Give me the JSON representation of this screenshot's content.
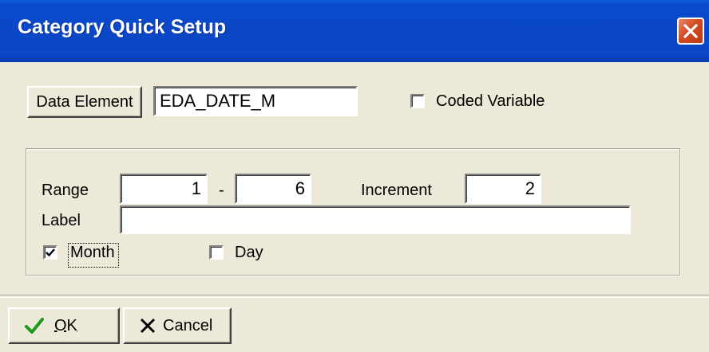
{
  "window": {
    "title": "Category Quick Setup"
  },
  "data_element": {
    "button_label": "Data Element",
    "value": "EDA_DATE_M"
  },
  "coded_variable": {
    "label": "Coded Variable",
    "checked": false
  },
  "range": {
    "label": "Range",
    "from": "1",
    "separator": "-",
    "to": "6"
  },
  "increment": {
    "label": "Increment",
    "value": "2"
  },
  "label_field": {
    "label": "Label",
    "value": ""
  },
  "month": {
    "label": "Month",
    "checked": true
  },
  "day": {
    "label": "Day",
    "checked": false
  },
  "buttons": {
    "ok": "OK",
    "cancel": "Cancel"
  },
  "colors": {
    "title_bar": "#0b48c8",
    "dialog_bg": "#ece9d8",
    "close_button": "#d04a22",
    "ok_check": "#1a9a1a"
  }
}
